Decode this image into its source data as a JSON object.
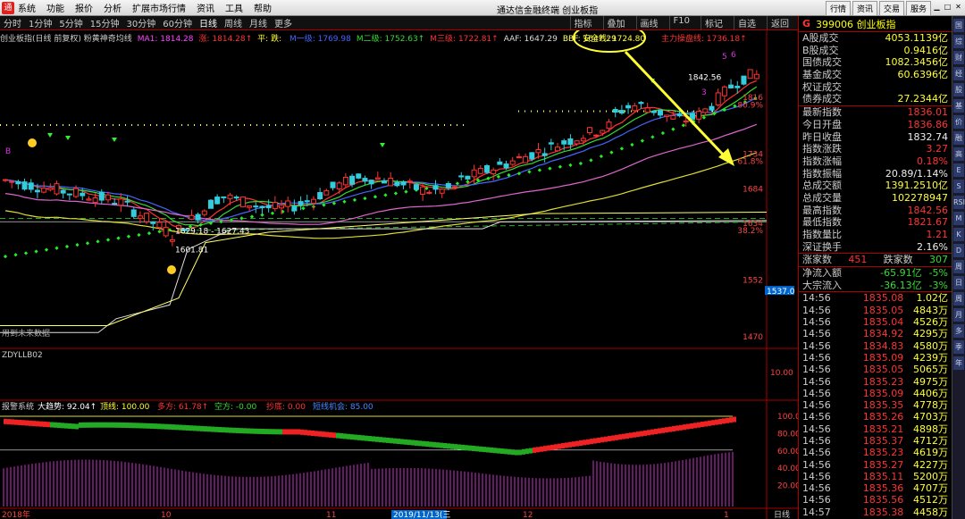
{
  "menu": [
    "系统",
    "功能",
    "报价",
    "分析",
    "扩展市场行情",
    "资讯",
    "工具",
    "帮助"
  ],
  "window_title": "通达信金融终端  创业板指",
  "top_right_buttons": [
    "行情",
    "资讯",
    "交易",
    "服务"
  ],
  "periods": [
    "分时",
    "1分钟",
    "5分钟",
    "15分钟",
    "30分钟",
    "60分钟",
    "日线",
    "周线",
    "月线",
    "更多"
  ],
  "active_period": "日线",
  "period_right_buttons": [
    "指标",
    "叠加",
    "画线",
    "F10",
    "标记",
    "自选",
    "返回"
  ],
  "indicator_line": {
    "name": "创业板指(日线 前复权) 粉黄神奇均线",
    "items": [
      {
        "text": "MA1: 1814.28",
        "color": "#ff44ff"
      },
      {
        "text": "涨: 1814.28↑",
        "color": "#ff3333"
      },
      {
        "text": "平: 跌: ",
        "color": "#ffff33"
      },
      {
        "text": "M一级: 1769.98",
        "color": "#4466ff"
      },
      {
        "text": "M二级: 1752.63↑",
        "color": "#33dd33"
      },
      {
        "text": "M三级: 1722.81↑",
        "color": "#ff3333"
      },
      {
        "text": "AAF: 1647.29",
        "color": "#dddddd"
      },
      {
        "text": "BBF: 1647.29",
        "color": "#ffff66"
      }
    ],
    "safety_line": "安全线: 1724.80",
    "main_line": "主力操盘线: 1736.18↑"
  },
  "main_chart": {
    "axis_labels": [
      {
        "text": "1816",
        "color": "#ff4444"
      },
      {
        "text": "80.9%",
        "color": "#ff4444"
      },
      {
        "text": "1734",
        "color": "#ff4444"
      },
      {
        "text": "61.8%",
        "color": "#ff4444"
      },
      {
        "text": "1684",
        "color": "#ff4444"
      },
      {
        "text": "1634",
        "color": "#ff4444"
      },
      {
        "text": "38.2%",
        "color": "#ff4444"
      },
      {
        "text": "1552",
        "color": "#ff4444"
      },
      {
        "text": "1537.0",
        "color": "#ffffff"
      },
      {
        "text": "1470",
        "color": "#ff4444"
      }
    ],
    "annotations": {
      "high_label": "1842.56",
      "low_label": "1601.81",
      "range_label": "1629.18 - 1627.43",
      "future_label": "用到未来数据",
      "wave_labels": [
        "5",
        "6",
        "3",
        "B"
      ]
    }
  },
  "sub1": {
    "name": "ZDYLLB02",
    "axis_label": "10.00"
  },
  "sub2": {
    "label": "报警系统",
    "items": [
      {
        "text": "大趋势: 92.04↑",
        "color": "#ffffff"
      },
      {
        "text": "顶线: 100.00",
        "color": "#ffff33"
      },
      {
        "text": "多方: 61.78↑",
        "color": "#ff3333"
      },
      {
        "text": "空方: -0.00",
        "color": "#33dd33"
      },
      {
        "text": "抄底: 0.00",
        "color": "#ff3333"
      },
      {
        "text": "短线机会: 85.00",
        "color": "#4488ff"
      }
    ],
    "axis_labels": [
      "100.0",
      "80.00",
      "60.00",
      "40.00",
      "20.00"
    ]
  },
  "xaxis": [
    "2018年",
    "10",
    "11",
    "2019/11/13(三",
    "12",
    "1",
    "日线"
  ],
  "rpanel": {
    "g": "G",
    "code": "399006 创业板指",
    "stats": [
      {
        "k": "A股成交",
        "v": "4053.1139亿",
        "c": "yellow"
      },
      {
        "k": "B股成交",
        "v": "0.9416亿",
        "c": "yellow"
      },
      {
        "k": "国债成交",
        "v": "1082.3456亿",
        "c": "yellow"
      },
      {
        "k": "基金成交",
        "v": "60.6396亿",
        "c": "yellow"
      },
      {
        "k": "权证成交",
        "v": "",
        "c": "yellow"
      },
      {
        "k": "债券成交",
        "v": "27.2344亿",
        "c": "yellow"
      }
    ],
    "quote": [
      {
        "k": "最新指数",
        "v": "1836.01",
        "c": "red"
      },
      {
        "k": "今日开盘",
        "v": "1836.86",
        "c": "red"
      },
      {
        "k": "昨日收盘",
        "v": "1832.74",
        "c": "white"
      },
      {
        "k": "指数涨跌",
        "v": "3.27",
        "c": "red"
      },
      {
        "k": "指数涨幅",
        "v": "0.18%",
        "c": "red"
      },
      {
        "k": "指数振幅",
        "v": "20.89/1.14%",
        "c": "white"
      },
      {
        "k": "总成交额",
        "v": "1391.2510亿",
        "c": "yellow"
      },
      {
        "k": "总成交量",
        "v": "102278947",
        "c": "yellow"
      },
      {
        "k": "最高指数",
        "v": "1842.56",
        "c": "red"
      },
      {
        "k": "最低指数",
        "v": "1821.67",
        "c": "red"
      },
      {
        "k": "指数量比",
        "v": "1.21",
        "c": "red"
      },
      {
        "k": "深证换手",
        "v": "2.16%",
        "c": "white"
      }
    ],
    "updown": {
      "up_label": "涨家数",
      "up": "451",
      "down_label": "跌家数",
      "down": "307"
    },
    "flows": [
      {
        "k": "净流入额",
        "v": "-65.91亿",
        "p": "-5%"
      },
      {
        "k": "大宗流入",
        "v": "-36.13亿",
        "p": "-3%"
      }
    ],
    "ticks": [
      [
        "14:56",
        "1835.08",
        "1.02亿"
      ],
      [
        "14:56",
        "1835.05",
        "4843万"
      ],
      [
        "14:56",
        "1835.04",
        "4526万"
      ],
      [
        "14:56",
        "1834.92",
        "4295万"
      ],
      [
        "14:56",
        "1834.83",
        "4580万"
      ],
      [
        "14:56",
        "1835.09",
        "4239万"
      ],
      [
        "14:56",
        "1835.05",
        "5065万"
      ],
      [
        "14:56",
        "1835.23",
        "4975万"
      ],
      [
        "14:56",
        "1835.09",
        "4406万"
      ],
      [
        "14:56",
        "1835.35",
        "4778万"
      ],
      [
        "14:56",
        "1835.26",
        "4703万"
      ],
      [
        "14:56",
        "1835.21",
        "4898万"
      ],
      [
        "14:56",
        "1835.37",
        "4712万"
      ],
      [
        "14:56",
        "1835.23",
        "4619万"
      ],
      [
        "14:56",
        "1835.27",
        "4227万"
      ],
      [
        "14:56",
        "1835.11",
        "5200万"
      ],
      [
        "14:56",
        "1835.36",
        "4707万"
      ],
      [
        "14:56",
        "1835.56",
        "4512万"
      ],
      [
        "14:57",
        "1835.38",
        "4458万"
      ]
    ]
  },
  "sidebar": [
    "国",
    "综",
    "财",
    "经",
    "股",
    "基",
    "价",
    "融",
    "高",
    "E",
    "S",
    "RSI",
    "M",
    "K",
    "D",
    "周",
    "日",
    "周",
    "月",
    "多",
    "季",
    "年"
  ],
  "colors": {
    "up": "#ff3333",
    "down": "#33ccdd",
    "bg": "#000000",
    "border": "#aa0000"
  }
}
